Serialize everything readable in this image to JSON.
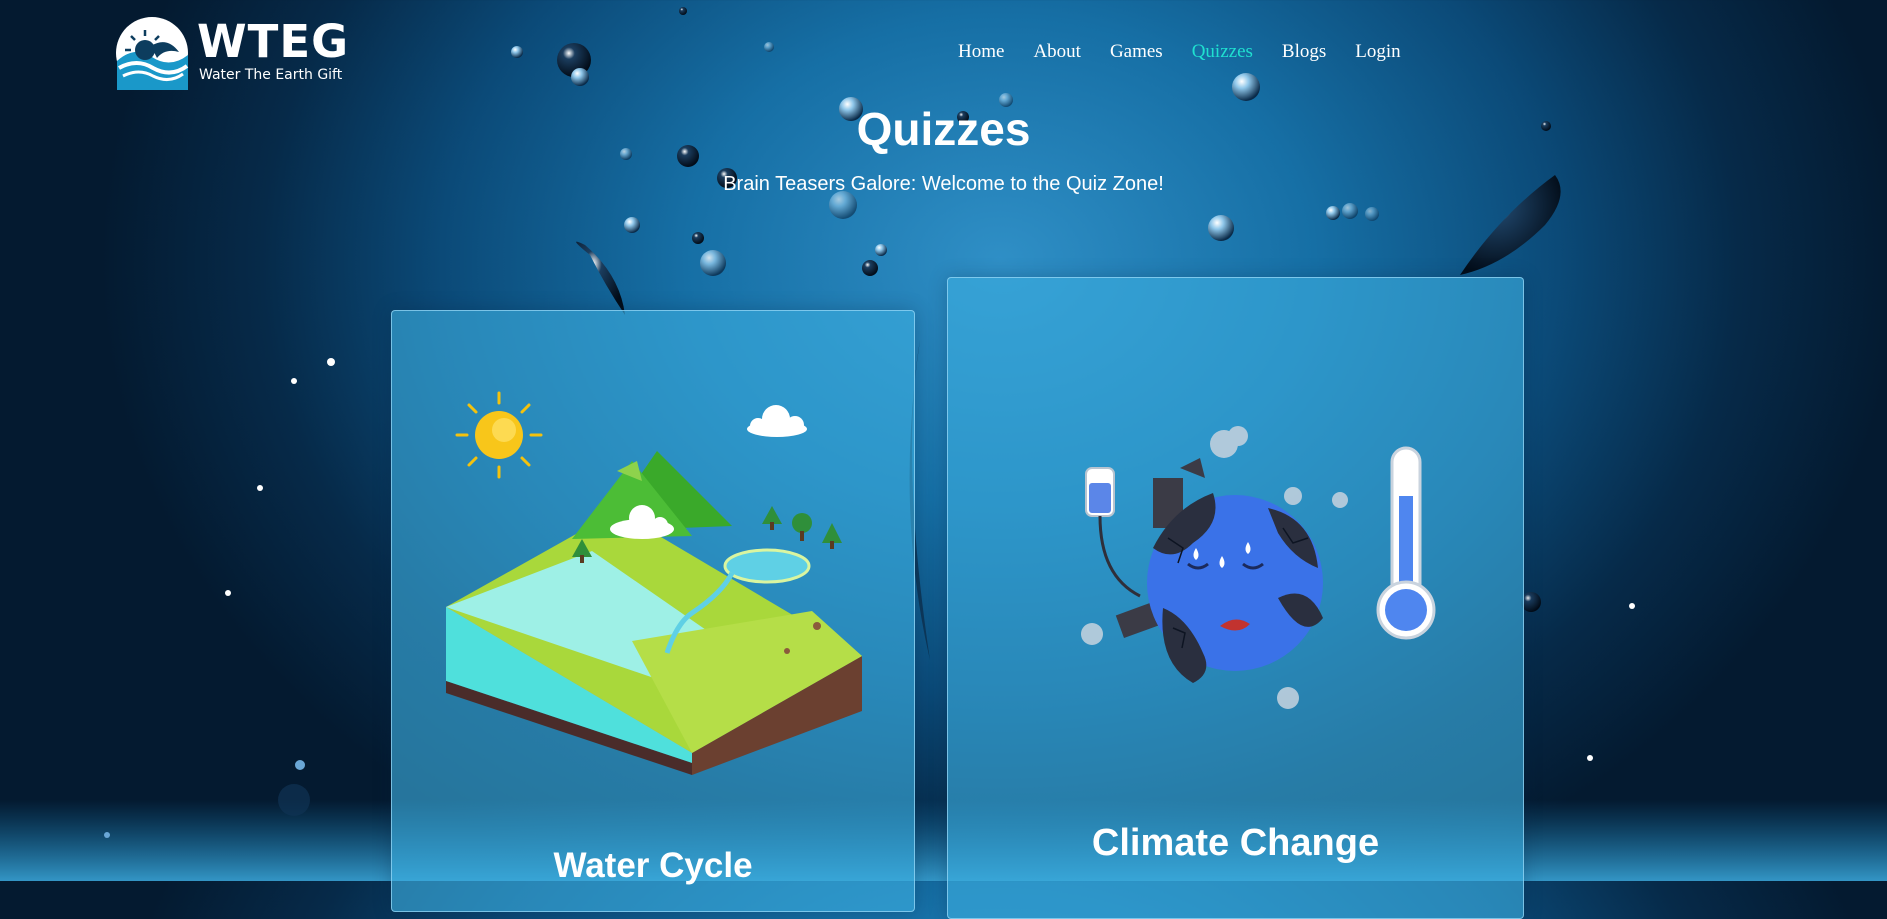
{
  "brand": {
    "title": "WTEG",
    "subtitle": "Water The Earth Gift"
  },
  "nav": [
    {
      "label": "Home"
    },
    {
      "label": "About"
    },
    {
      "label": "Games"
    },
    {
      "label": "Quizzes",
      "active": true
    },
    {
      "label": "Blogs"
    },
    {
      "label": "Login"
    }
  ],
  "page": {
    "title": "Quizzes",
    "subtitle": "Brain Teasers Galore: Welcome to the Quiz Zone!"
  },
  "quizzes": [
    {
      "title": "Water Cycle",
      "icon": "water-cycle-island-illustration"
    },
    {
      "title": "Climate Change",
      "icon": "sick-earth-thermometer-illustration"
    }
  ],
  "colors": {
    "accent": "#1fe0d0",
    "text": "#ffffff",
    "card": "#3cafe1"
  }
}
